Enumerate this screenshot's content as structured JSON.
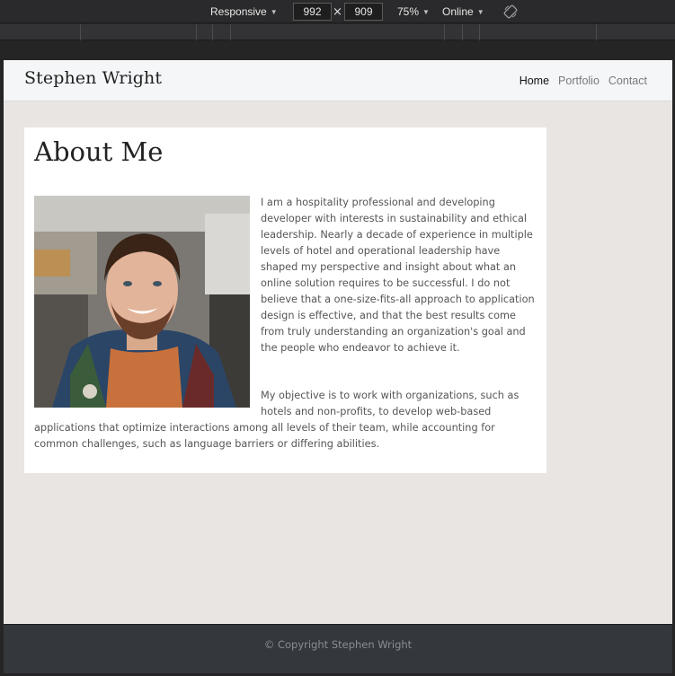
{
  "devtools": {
    "device_label": "Responsive",
    "width_value": "992",
    "height_value": "909",
    "times_sign": "×",
    "zoom_label": "75%",
    "network_label": "Online"
  },
  "site": {
    "brand": "Stephen Wright",
    "nav": [
      {
        "label": "Home",
        "active": true
      },
      {
        "label": "Portfolio",
        "active": false
      },
      {
        "label": "Contact",
        "active": false
      }
    ],
    "about": {
      "heading": "About Me",
      "paragraph_1": "I am a hospitality professional and developing developer with interests in sustainability and ethical leadership. Nearly a decade of experience in multiple levels of hotel and operational leadership have shaped my perspective and insight about what an online solution requires to be successful. I do not believe that a one-size-fits-all approach to application design is effective, and that the best results come from truly understanding an organization's goal and the people who endeavor to achieve it.",
      "paragraph_2": "My objective is to work with organizations, such as hotels and non-profits, to develop web-based applications that optimize interactions among all levels of their team, while accounting for common challenges, such as language barriers or differing abilities.",
      "photo_icon": "profile-photo"
    },
    "footer": {
      "copyright": "© Copyright Stephen Wright"
    }
  },
  "colors": {
    "page_background": "#e9e5e2",
    "navbar": "#f5f6f7",
    "footer": "#34373c",
    "devtools": "#2a2a2c"
  }
}
